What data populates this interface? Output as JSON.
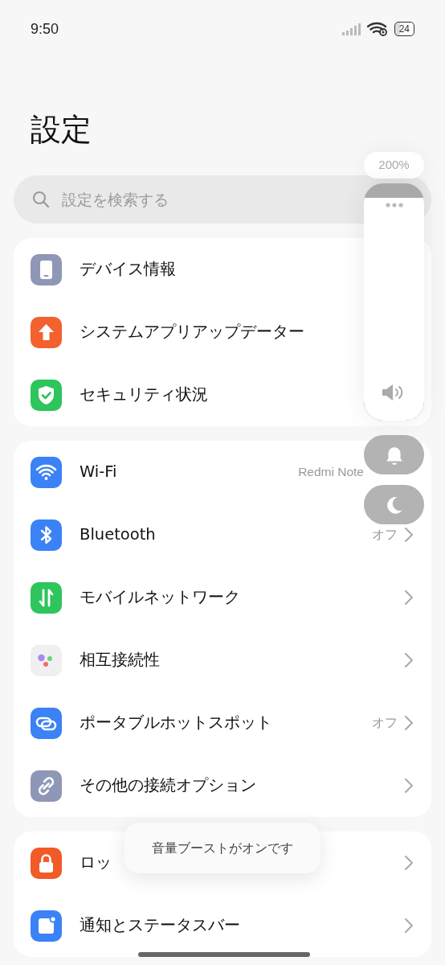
{
  "status_bar": {
    "time": "9:50",
    "battery": "24"
  },
  "title": "設定",
  "search": {
    "placeholder": "設定を検索する"
  },
  "groups": [
    {
      "items": [
        {
          "kind": "device",
          "label": "デバイス情報",
          "chevron": false
        },
        {
          "kind": "update",
          "label": "システムアプリアップデーター",
          "chevron": false
        },
        {
          "kind": "shield",
          "label": "セキュリティ状況",
          "chevron": false
        }
      ]
    },
    {
      "items": [
        {
          "kind": "wifi",
          "label": "Wi-Fi",
          "value": "Redmi Note",
          "chevron": false
        },
        {
          "kind": "bluetooth",
          "label": "Bluetooth",
          "value": "オフ",
          "chevron": true
        },
        {
          "kind": "mobile",
          "label": "モバイルネットワーク",
          "chevron": true
        },
        {
          "kind": "interconnect",
          "label": "相互接続性",
          "chevron": true
        },
        {
          "kind": "hotspot",
          "label": "ポータブルホットスポット",
          "value": "オフ",
          "chevron": true
        },
        {
          "kind": "link",
          "label": "その他の接続オプション",
          "chevron": true
        }
      ]
    },
    {
      "items": [
        {
          "kind": "lock",
          "label": "ロッ",
          "chevron": true
        },
        {
          "kind": "notification",
          "label": "通知とステータスバー",
          "chevron": true
        }
      ]
    }
  ],
  "volume_panel": {
    "boost": "200%",
    "level": 0.94,
    "buttons": [
      {
        "kind": "bell"
      },
      {
        "kind": "moon"
      }
    ]
  },
  "toast": {
    "text": "音量ブーストがオンです"
  }
}
